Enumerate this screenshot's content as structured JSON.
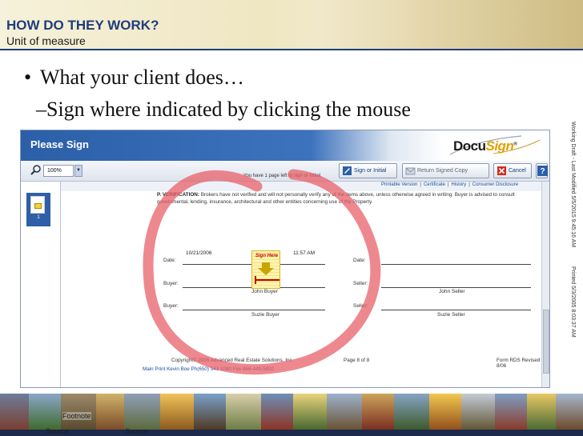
{
  "header": {
    "title": "HOW DO THEY WORK?",
    "subtitle": "Unit of measure"
  },
  "bullets": {
    "level1": "What your client does…",
    "level1_marker": "•",
    "level2": "–Sign where indicated by clicking the mouse"
  },
  "side_text": {
    "left": "Working Draft - Last Modified 5/5/2015 9:45:16 AM",
    "right": "Printed 5/3/2005 8:03:37 AM"
  },
  "screenshot": {
    "title": "Please Sign",
    "logo": {
      "docu": "Docu",
      "sign": "Sign",
      "mark": "®"
    },
    "toolbar": {
      "zoom_value": "100%",
      "zoom_caret": "▼",
      "pages_left": "You have 1 page left to sign or initial.",
      "sign_button": "Sign or Initial",
      "return_button": "Return Signed Copy",
      "cancel_button": "Cancel",
      "help_button": "?"
    },
    "links": [
      "Printable Version",
      "Certificate",
      "History",
      "Consumer Disclosure"
    ],
    "link_separator": "|",
    "thumbnail": {
      "page_number": "1"
    },
    "document": {
      "verification_heading": "P. VERIFICATION:",
      "verification_text": " Brokers have not verified and will not personally verify any of the items above, unless otherwise agreed in writing. Buyer is advised to consult governmental, lending, insurance, architectural and other entities concerning use of the Property.",
      "date_label": "Date:",
      "date_value": "10/21/2006",
      "time_value": "11:57 AM",
      "buyer_label": "Buyer:",
      "seller_label": "Seller:",
      "buyer1_name": "John Buyer",
      "buyer2_name": "Suzie Buyer",
      "seller1_name": "John Seller",
      "seller2_name": "Suzie Seller",
      "sign_here": "Sign Here",
      "copyright": "Copyright© 2005 Advanced Real Estate Solutions, Inc",
      "main_print": "Main Print  Kevin Boe Ph(650) 543 1080 Fax 866-449-5820",
      "page_info": "Page 8 of 8",
      "form_info": "Form RDS Revised 8/06"
    },
    "annotation_color": "#e8606a"
  },
  "bottom": {
    "footnote": "Footnote",
    "source1": "Source:",
    "source2": "Source:"
  }
}
